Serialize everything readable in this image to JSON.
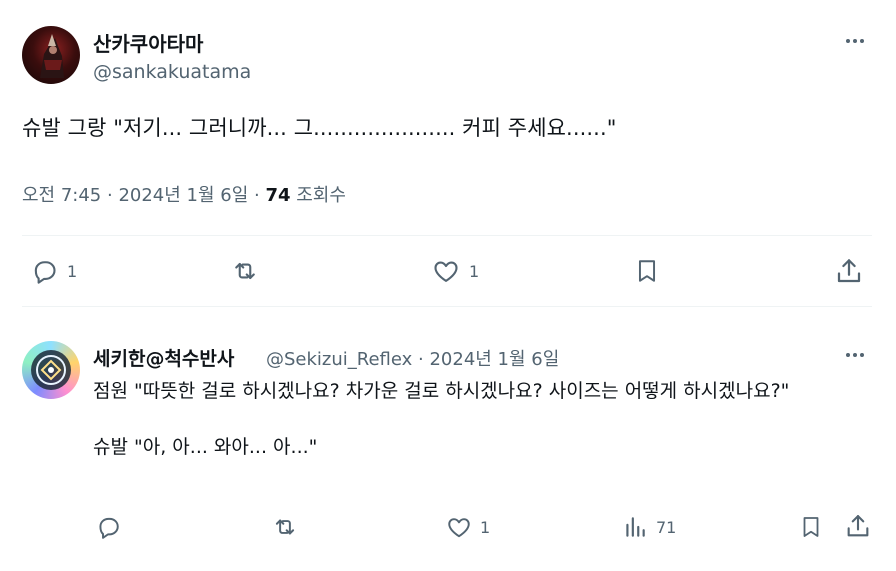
{
  "main_tweet": {
    "display_name": "산카쿠아타마",
    "handle": "@sankakuatama",
    "text": "슈발 그랑 \"저기... 그러니까... 그..................... 커피 주세요......\"",
    "time": "오전 7:45",
    "separator": " · ",
    "date": "2024년 1월 6일",
    "views_count": "74",
    "views_label": " 조회수",
    "actions": {
      "reply_count": "1",
      "retweet_count": "",
      "like_count": "1"
    }
  },
  "reply_tweet": {
    "display_name": "세키한@척수반사",
    "handle": "@Sekizui_Reflex",
    "date": "2024년 1월 6일",
    "handle_line": "@Sekizui_Reflex · 2024년 1월 6일",
    "text": "점원 \"따뜻한 걸로 하시겠나요? 차가운 걸로 하시겠나요? 사이즈는 어떻게 하시겠나요?\"\n\n슈발 \"아, 아... 와아... 아...\"",
    "actions": {
      "reply_count": "",
      "retweet_count": "",
      "like_count": "1",
      "views_count": "71"
    }
  },
  "icons": [
    "more-icon",
    "reply-icon",
    "retweet-icon",
    "like-icon",
    "bookmark-icon",
    "share-icon",
    "views-icon"
  ],
  "colors": {
    "text_primary": "#0f1419",
    "text_secondary": "#536471",
    "divider": "#eff3f4",
    "background": "#ffffff"
  }
}
